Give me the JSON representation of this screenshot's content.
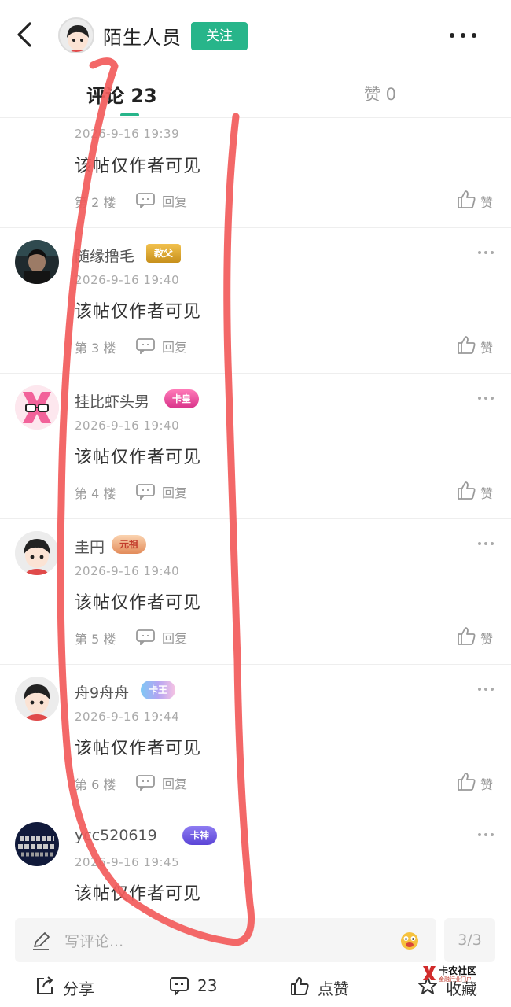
{
  "header": {
    "user_name": "陌生人员",
    "follow_label": "关注"
  },
  "tabs": {
    "comments_label": "评论 23",
    "likes_label": "赞 0"
  },
  "comments": [
    {
      "name": "",
      "badge": "",
      "time": "2026-9-16 19:39",
      "text": "该帖仅作者可见",
      "floor": "第 2 楼",
      "reply": "回复",
      "like": "赞"
    },
    {
      "name": "随缘撸毛",
      "badge": "教父",
      "time": "2026-9-16 19:40",
      "text": "该帖仅作者可见",
      "floor": "第 3 楼",
      "reply": "回复",
      "like": "赞"
    },
    {
      "name": "挂比虾头男",
      "badge": "卡皇",
      "time": "2026-9-16 19:40",
      "text": "该帖仅作者可见",
      "floor": "第 4 楼",
      "reply": "回复",
      "like": "赞"
    },
    {
      "name": "圭円",
      "badge": "元祖",
      "time": "2026-9-16 19:40",
      "text": "该帖仅作者可见",
      "floor": "第 5 楼",
      "reply": "回复",
      "like": "赞"
    },
    {
      "name": "舟9舟舟",
      "badge": "卡王",
      "time": "2026-9-16 19:44",
      "text": "该帖仅作者可见",
      "floor": "第 6 楼",
      "reply": "回复",
      "like": "赞"
    },
    {
      "name": "ycc520619",
      "badge": "卡神",
      "time": "2026-9-16 19:45",
      "text": "该帖仅作者可见",
      "floor": "",
      "reply": "",
      "like": ""
    }
  ],
  "comment_bar": {
    "placeholder": "写评论...",
    "page_indicator": "3/3"
  },
  "bottom_actions": {
    "share": "分享",
    "comments": "23",
    "like": "点赞",
    "favorite": "收藏"
  },
  "watermark": {
    "title": "卡农社区",
    "subtitle": "金融行业门户"
  },
  "colors": {
    "accent": "#27b58a",
    "annotation_red": "#f25b5b"
  }
}
